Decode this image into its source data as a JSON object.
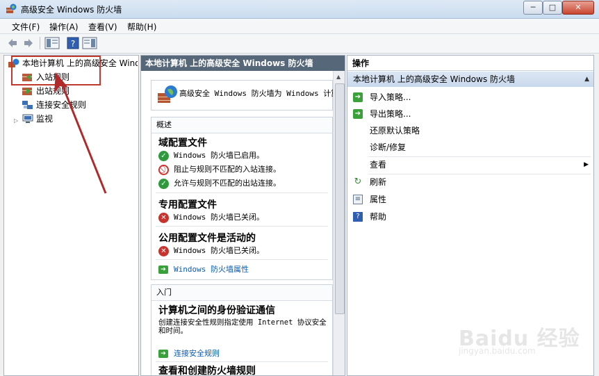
{
  "window": {
    "title": "高级安全 Windows 防火墙",
    "min_label": "─",
    "max_label": "□",
    "close_label": "✕"
  },
  "menu": {
    "items": [
      "文件(F)",
      "操作(A)",
      "查看(V)",
      "帮助(H)"
    ]
  },
  "tree": {
    "root": "本地计算机 上的高级安全 Wind",
    "items": [
      "入站规则",
      "出站规则",
      "连接安全规则",
      "监视"
    ]
  },
  "center": {
    "header": "本地计算机 上的高级安全 Windows 防火墙",
    "intro": "高级安全 Windows 防火墙为 Windows 计算",
    "overview": {
      "head": "概述",
      "domain_title": "域配置文件",
      "domain_rows": [
        "Windows 防火墙已启用。",
        "阻止与规则不匹配的入站连接。",
        "允许与规则不匹配的出站连接。"
      ],
      "private_title": "专用配置文件",
      "private_row": "Windows 防火墙已关闭。",
      "public_title": "公用配置文件是活动的",
      "public_row": "Windows 防火墙已关闭。",
      "props_link": "Windows 防火墙属性"
    },
    "getting_started": {
      "head": "入门",
      "title": "计算机之间的身份验证通信",
      "desc": "创建连接安全性规则指定使用 Internet 协议安全和时间。",
      "link": "连接安全规则",
      "next_title": "查看和创建防火墙规则"
    }
  },
  "actions": {
    "title": "操作",
    "section": "本地计算机 上的高级安全 Windows 防火墙",
    "items": [
      "导入策略...",
      "导出策略...",
      "还原默认策略",
      "诊断/修复",
      "查看",
      "刷新",
      "属性",
      "帮助"
    ]
  },
  "watermark": {
    "main": "Baidu 经验",
    "sub": "jingyan.baidu.com"
  },
  "colors": {
    "accent_red": "#c0392b",
    "header_dark": "#566779",
    "link_blue": "#0b5cb5"
  }
}
